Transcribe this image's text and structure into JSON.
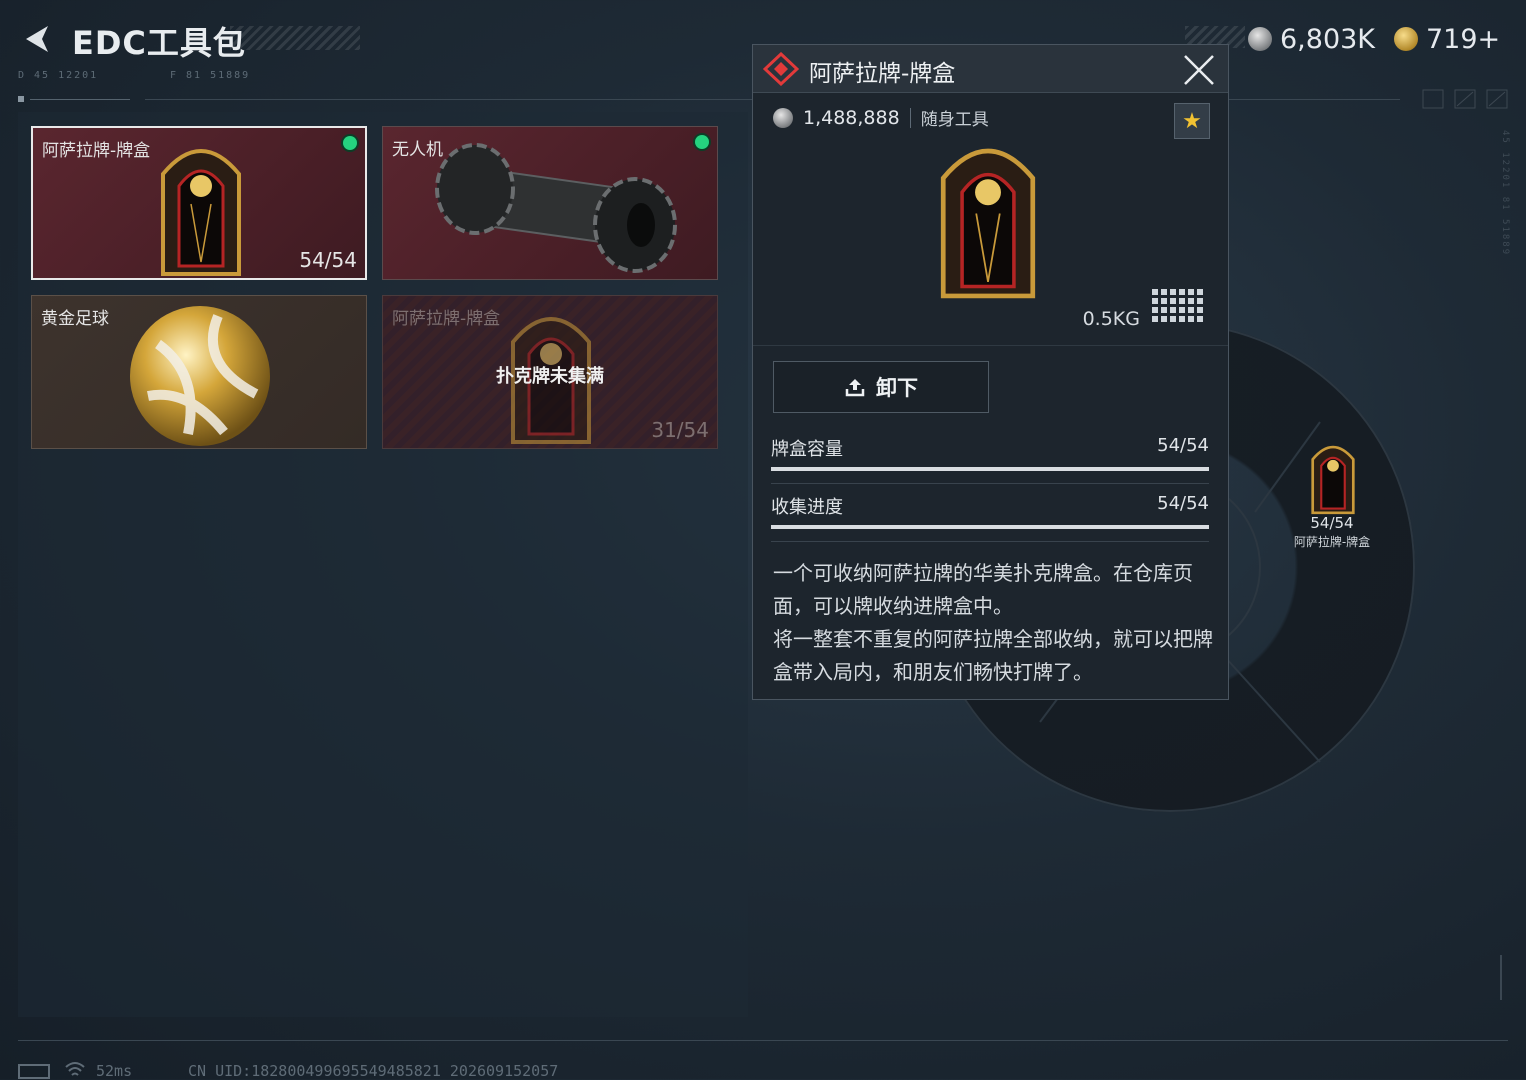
{
  "header": {
    "title": "EDC工具包",
    "code_left": "D 45  12201",
    "code_right": "F 81  51889"
  },
  "currency": [
    {
      "icon": "silver-coin-icon",
      "value": "6,803K"
    },
    {
      "icon": "gold-coin-icon",
      "value": "719+"
    }
  ],
  "items": [
    {
      "label": "阿萨拉牌-牌盒",
      "count": "54/54",
      "status": "equipped"
    },
    {
      "label": "无人机",
      "count": "",
      "status": "equipped"
    },
    {
      "label": "黄金足球",
      "count": "",
      "status": ""
    },
    {
      "label": "阿萨拉牌-牌盒",
      "count": "31/54",
      "overlay": "扑克牌未集满"
    }
  ],
  "popup": {
    "title": "阿萨拉牌-牌盒",
    "value": "1,488,888",
    "tag": "随身工具",
    "weight": "0.5KG",
    "unload_label": "卸下",
    "stats": [
      {
        "label": "牌盒容量",
        "value": "54/54",
        "fraction": 1.0
      },
      {
        "label": "收集进度",
        "value": "54/54",
        "fraction": 1.0
      }
    ],
    "description": [
      "一个可收纳阿萨拉牌的华美扑克牌盒。在仓库页面，可以牌收纳进牌盒中。",
      "将一整套不重复的阿萨拉牌全部收纳，就可以把牌盒带入局内，和朋友们畅快打牌了。"
    ]
  },
  "slot": {
    "count": "54/54",
    "name": "阿萨拉牌-牌盒"
  },
  "footer": {
    "ping": "52ms",
    "uid": "CN UID:182800499695549485821 202609152057"
  },
  "colors": {
    "accent_red": "#e23a3a",
    "equipped_dot": "#25d37f",
    "favorite_star": "#f2c232"
  }
}
